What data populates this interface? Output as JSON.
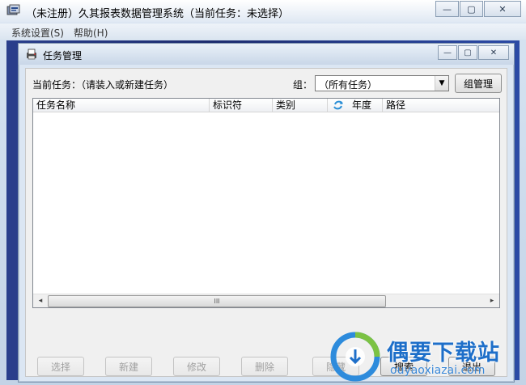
{
  "window": {
    "title": "（未注册）久其报表数据管理系统（当前任务：未选择）",
    "minimize_glyph": "—",
    "maximize_glyph": "▢",
    "close_glyph": "✕"
  },
  "menu": {
    "items": [
      {
        "label": "系统设置(S)"
      },
      {
        "label": "帮助(H)"
      }
    ]
  },
  "child_window": {
    "title": "任务管理",
    "minimize_glyph": "—",
    "maximize_glyph": "▢",
    "close_glyph": "✕"
  },
  "task_panel": {
    "current_task_label": "当前任务：（请装入或新建任务）",
    "group_label": "组：",
    "group_selected": "（所有任务）",
    "group_manage_button": "组管理"
  },
  "table": {
    "columns": [
      "任务名称",
      "标识符",
      "类别",
      "年度",
      "路径"
    ],
    "rows": []
  },
  "scrollbar": {
    "left_arrow": "◂",
    "right_arrow": "▸",
    "grip": "III"
  },
  "buttons": {
    "select": "选择",
    "new": "新建",
    "modify": "修改",
    "delete": "删除",
    "hide": "隐藏",
    "search": "搜索",
    "exit": "退出"
  },
  "watermark": {
    "brand": "偶要下载站",
    "url": "ouyaoxiazai.com"
  },
  "icons": {
    "app": "app-icon",
    "child": "task-window-icon",
    "refresh": "refresh-icon"
  },
  "colors": {
    "mdi_background": "#22337a",
    "watermark_blue": "#1e6fc9"
  }
}
